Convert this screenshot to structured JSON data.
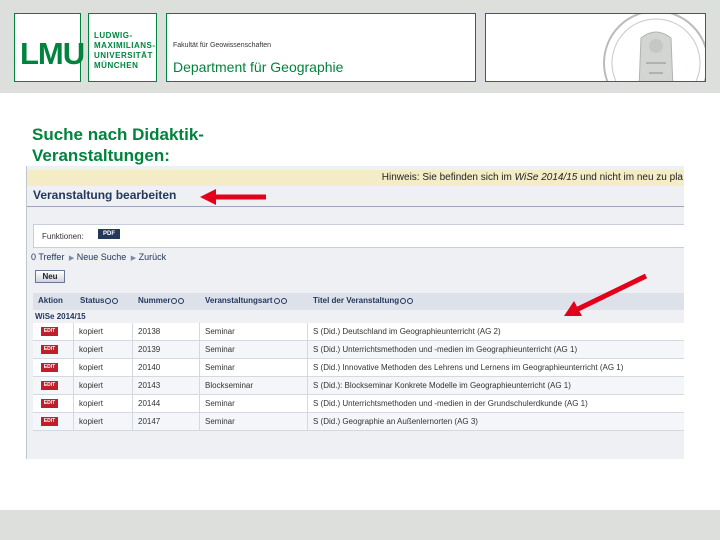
{
  "header": {
    "logo_text": "LMU",
    "university_lines": [
      "LUDWIG-",
      "MAXIMILIANS-",
      "UNIVERSITÄT",
      "MÜNCHEN"
    ],
    "faculty": "Fakultät für Geowissenschaften",
    "department": "Department für Geographie"
  },
  "slide": {
    "title_line1": "Suche nach Didaktik-",
    "title_line2": "Veranstaltungen:"
  },
  "screenshot": {
    "hint_prefix": "Hinweis: Sie befinden sich im ",
    "hint_semester": "WiSe 2014/15",
    "hint_suffix": " und nicht im neu zu pla",
    "page_title": "Veranstaltung bearbeiten",
    "functions_label": "Funktionen:",
    "pdf_label": "PDF",
    "nav": {
      "hits": "0 Treffer",
      "new_search": "Neue Suche",
      "back": "Zurück"
    },
    "new_button": "Neu",
    "semester": "WiSe 2014/15",
    "columns": [
      "Aktion",
      "Status",
      "Nummer",
      "Veranstaltungsart",
      "Titel der Veranstaltung"
    ],
    "edit_label": "EDIT",
    "rows": [
      {
        "status": "kopiert",
        "nummer": "20138",
        "art": "Seminar",
        "titel": "S (Did.) Deutschland im Geographieunterricht (AG 2)"
      },
      {
        "status": "kopiert",
        "nummer": "20139",
        "art": "Seminar",
        "titel": "S (Did.) Unterrichtsmethoden und -medien im Geographieunterricht (AG 1)"
      },
      {
        "status": "kopiert",
        "nummer": "20140",
        "art": "Seminar",
        "titel": "S (Did.) Innovative Methoden des Lehrens und Lernens im Geographieunterricht (AG 1)"
      },
      {
        "status": "kopiert",
        "nummer": "20143",
        "art": "Blockseminar",
        "titel": "S (Did.): Blockseminar Konkrete Modelle im Geographieunterricht (AG 1)"
      },
      {
        "status": "kopiert",
        "nummer": "20144",
        "art": "Seminar",
        "titel": "S (Did.) Unterrichtsmethoden und -medien in der Grundschulerdkunde (AG 1)"
      },
      {
        "status": "kopiert",
        "nummer": "20147",
        "art": "Seminar",
        "titel": "S (Did.) Geographie an Außenlernorten (AG 3)"
      }
    ]
  },
  "colors": {
    "lmu_green": "#00843d",
    "arrow_red": "#e2001a",
    "nav_blue": "#24385c"
  }
}
